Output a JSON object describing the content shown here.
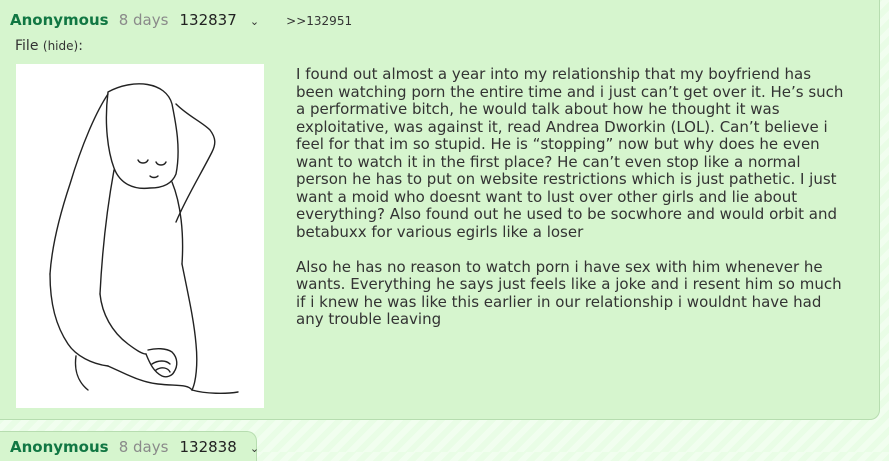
{
  "post": {
    "name": "Anonymous",
    "time": "8 days",
    "number": "132837",
    "menu_icon": "⌄",
    "backlink": ">>132951",
    "file_label": "File",
    "hide_label": "(hide)",
    "file_colon": ":",
    "thumbnail": "line-drawing-angel-thumbnail",
    "body": [
      "I found out almost a year into my relationship that my boyfriend has been watching porn the entire time and i just can’t get over it. He’s such a performative bitch, he would talk about how he thought it was exploitative, was against it, read Andrea Dworkin (LOL). Can’t believe i feel for that im so stupid. He is “stopping” now but why does he even want to watch it in the first place? He can’t even stop like a normal person he has to put on website restrictions which is just pathetic. I just want a moid who doesnt want to lust over other girls and lie about everything? Also found out he used to be socwhore and would orbit and betabuxx for various egirls like a loser",
      "Also he has no reason to watch porn i have sex with him whenever he wants. Everything he says just feels like a joke and i resent him so much if i knew he was like this earlier in our relationship i wouldnt have had any trouble leaving"
    ]
  },
  "post2": {
    "name": "Anonymous",
    "time": "8 days",
    "number": "132838",
    "menu_icon": "⌄"
  },
  "colors": {
    "page_bg": "#e9fde6",
    "post_bg": "#d6f5ce",
    "name": "#117743",
    "border": "#b7ddb0"
  }
}
